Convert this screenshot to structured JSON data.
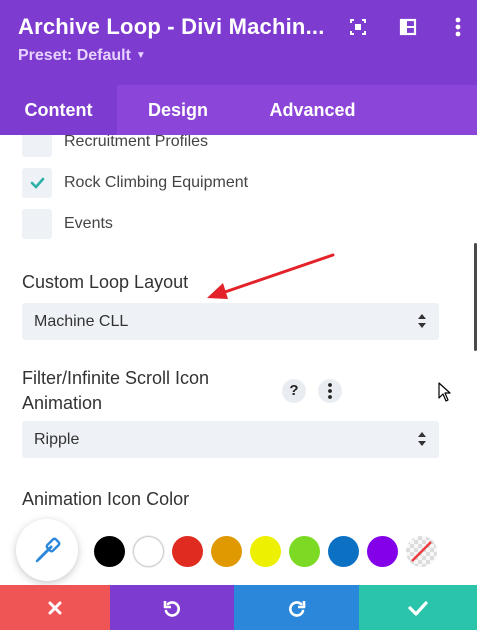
{
  "header": {
    "title": "Archive Loop - Divi Machin...",
    "preset_label": "Preset: Default",
    "icons": [
      "focus-icon",
      "sidebar-layout-icon",
      "more-options-icon"
    ]
  },
  "tabs": [
    {
      "label": "Content",
      "active": true
    },
    {
      "label": "Design",
      "active": false
    },
    {
      "label": "Advanced",
      "active": false
    }
  ],
  "categories": [
    {
      "label": "Recruitment Profiles",
      "checked": false
    },
    {
      "label": "Rock Climbing Equipment",
      "checked": true
    },
    {
      "label": "Events",
      "checked": false
    }
  ],
  "custom_loop_layout": {
    "label": "Custom Loop Layout",
    "value": "Machine CLL"
  },
  "icon_animation": {
    "label_line1": "Filter/Infinite Scroll Icon",
    "label_line2": "Animation",
    "help_icon": "?",
    "value": "Ripple"
  },
  "animation_icon_color": {
    "label": "Animation Icon Color",
    "swatches": [
      "#000000",
      "#ffffff",
      "#e02b20",
      "#e09900",
      "#edf000",
      "#7cda24",
      "#0c71c3",
      "#8300e9",
      "none"
    ]
  },
  "footer": {
    "buttons": [
      {
        "name": "discard",
        "color": "#ef5555",
        "icon": "close-icon"
      },
      {
        "name": "undo",
        "color": "#7e3bd0",
        "icon": "undo-icon"
      },
      {
        "name": "redo",
        "color": "#2b87da",
        "icon": "redo-icon"
      },
      {
        "name": "save",
        "color": "#29c4a9",
        "icon": "check-icon"
      }
    ]
  },
  "colors": {
    "header": "#7e3bd0",
    "tabs": "#8c45d9",
    "annotation_arrow": "#e3222a"
  }
}
